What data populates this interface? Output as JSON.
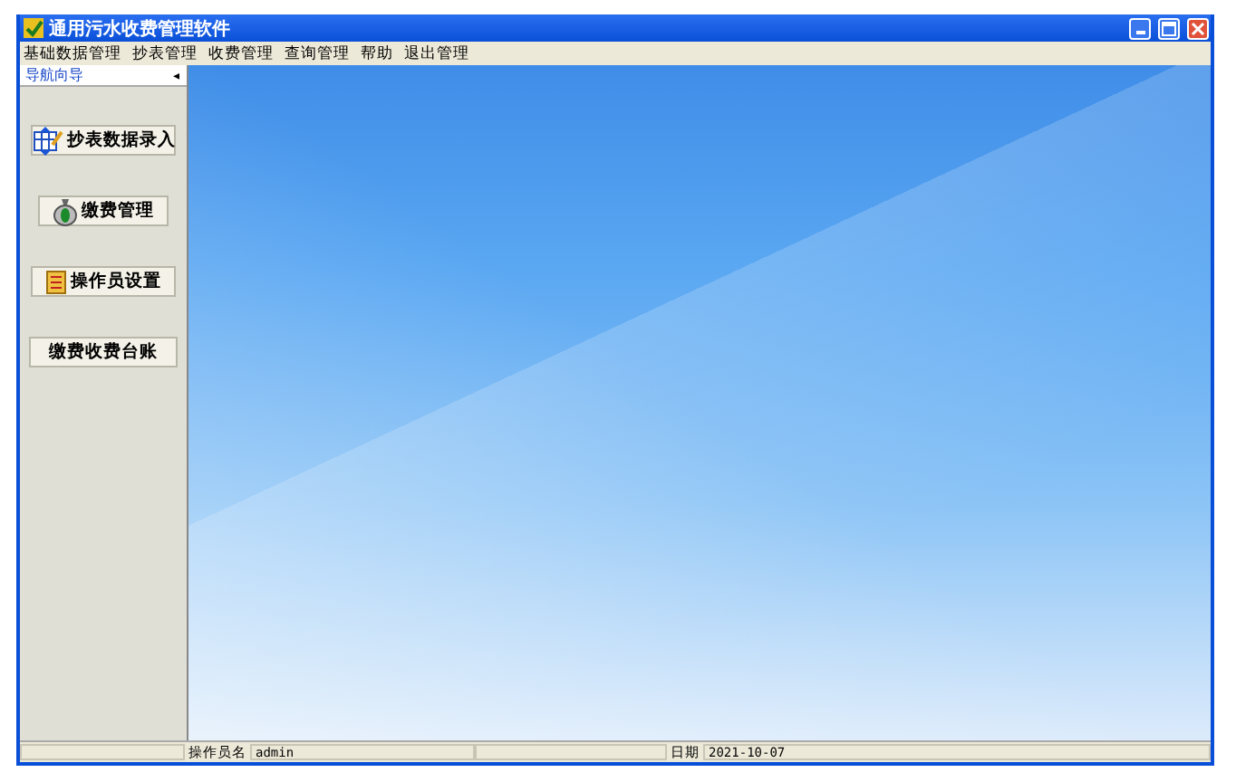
{
  "window": {
    "title": "通用污水收费管理软件"
  },
  "menu": [
    "基础数据管理",
    "抄表管理",
    "收费管理",
    "查询管理",
    "帮助",
    "退出管理"
  ],
  "nav": {
    "header": "导航向导",
    "collapse_glyph": "◂",
    "buttons": [
      {
        "label": "抄表数据录入",
        "kind": "table"
      },
      {
        "label": "缴费管理",
        "kind": "bag"
      },
      {
        "label": "操作员设置",
        "kind": "folder"
      },
      {
        "label": "缴费收费台账",
        "kind": "plain"
      }
    ]
  },
  "status_bar": {
    "operator_label": "操作员名",
    "operator": "admin",
    "date_label": "日期",
    "date": "2021-10-07"
  }
}
